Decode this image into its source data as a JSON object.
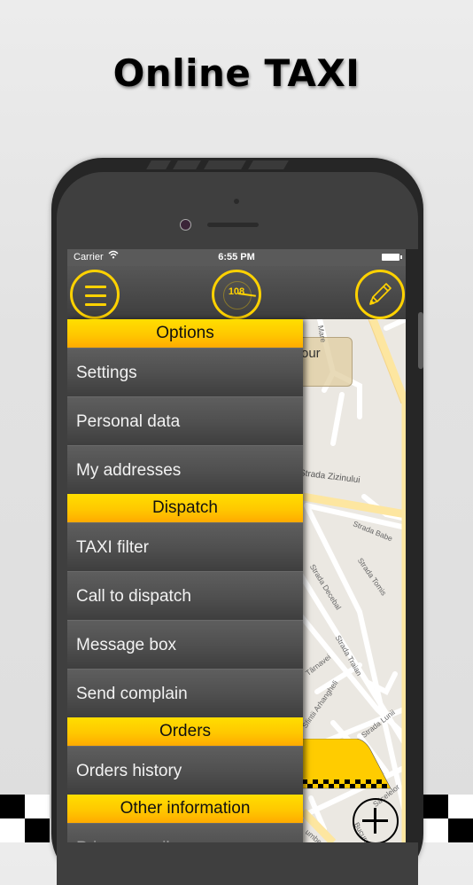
{
  "headline": "Online TAXI",
  "colors": {
    "accent_yellow": "#ffd200",
    "menu_bg": "#505050",
    "background": "#e2e2e2",
    "phone_frame": "#262626"
  },
  "statusbar": {
    "carrier": "Carrier",
    "wifi_icon": "wifi-icon",
    "time": "6:55 PM",
    "battery_icon": "battery-icon"
  },
  "navbar": {
    "menu_icon": "hamburger-menu-icon",
    "gauge_value": "108",
    "edit_icon": "pencil-icon"
  },
  "menu": {
    "sections": [
      {
        "title": "Options",
        "items": [
          "Settings",
          "Personal data",
          "My addresses"
        ]
      },
      {
        "title": "Dispatch",
        "items": [
          "TAXI filter",
          "Call to dispatch",
          "Message box",
          "Send complain"
        ]
      },
      {
        "title": "Orders",
        "items": [
          "Orders history"
        ]
      },
      {
        "title": "Other information",
        "items": [
          "Price per mile"
        ]
      }
    ]
  },
  "map": {
    "poi_label": "our",
    "streets": [
      "Mare",
      "Strada Zizinului",
      "Strada Babe",
      "Strada Tomis",
      "Strada Decebal",
      "Strada Traian",
      "Târnavei",
      "Sfintii Arhangheli",
      "Strada Lunii",
      "Săcelelor",
      "Bucuresti",
      "umbescu"
    ],
    "zoom_in_icon": "zoom-in-icon"
  }
}
